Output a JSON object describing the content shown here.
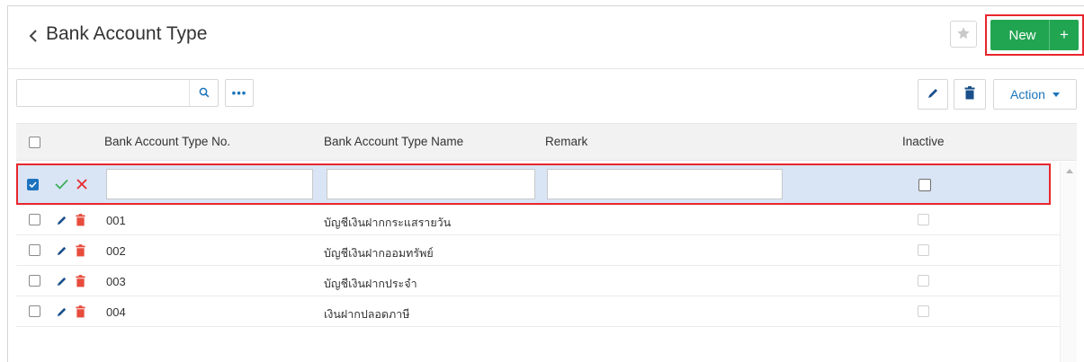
{
  "header": {
    "title": "Bank Account Type",
    "new_label": "New",
    "new_plus": "+"
  },
  "toolbar": {
    "search_value": "",
    "search_placeholder": "",
    "more_label": "•••",
    "action_label": "Action"
  },
  "table": {
    "columns": [
      "Bank Account Type No.",
      "Bank Account Type Name",
      "Remark",
      "Inactive"
    ],
    "edit_row": {
      "no": "",
      "name": "",
      "remark": ""
    },
    "rows": [
      {
        "no": "001",
        "name": "บัญชีเงินฝากกระแสรายวัน",
        "remark": ""
      },
      {
        "no": "002",
        "name": "บัญชีเงินฝากออมทรัพย์",
        "remark": ""
      },
      {
        "no": "003",
        "name": "บัญชีเงินฝากประจำ",
        "remark": ""
      },
      {
        "no": "004",
        "name": "เงินฝากปลอดภาษี",
        "remark": ""
      }
    ]
  },
  "colors": {
    "primary_green": "#22a551",
    "highlight_red": "#e8262c",
    "link_blue": "#1b75bb",
    "delete_red": "#e74c3c",
    "selected_row": "#d9e5f5"
  },
  "icons": [
    "chevron-left-icon",
    "star-icon",
    "search-icon",
    "more-icon",
    "pencil-icon",
    "trash-icon",
    "caret-down-icon",
    "check-icon",
    "close-icon",
    "scroll-up-icon"
  ]
}
